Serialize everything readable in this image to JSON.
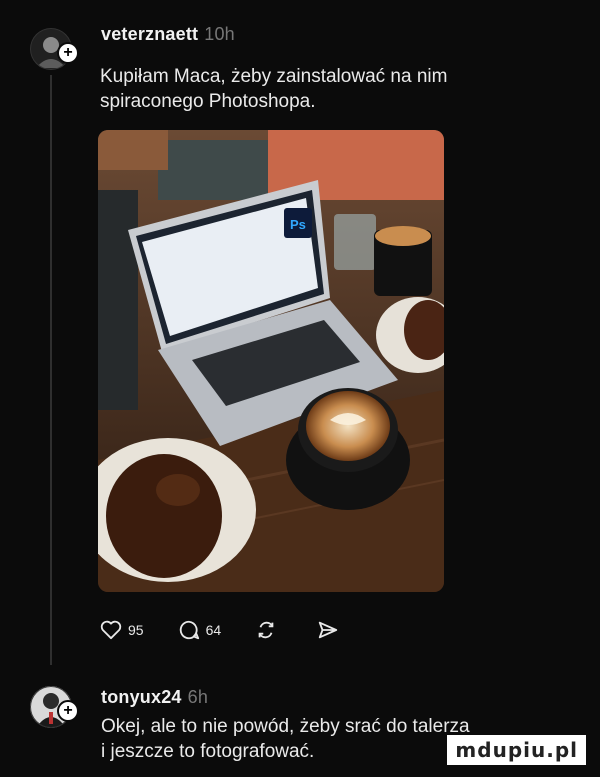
{
  "post": {
    "username": "veterznaett",
    "time": "10h",
    "text_line1": "Kupiłam Maca, żeby zainstalować na nim",
    "text_line2": "spiraconego Photoshopa.",
    "likes": "95",
    "comments": "64"
  },
  "reply": {
    "username": "tonyux24",
    "time": "6h",
    "text_line1": "Okej, ale to nie powód, żeby srać do talerza",
    "text_line2": "i jeszcze to fotografować."
  },
  "photo": {
    "ps_badge": "Ps"
  },
  "watermark": "mdupiu.pl",
  "icons": [
    "plus-icon",
    "heart-icon",
    "comment-icon",
    "repost-icon",
    "share-icon"
  ],
  "colors": {
    "background": "#0b0b0b",
    "text": "#f2f2f2",
    "muted": "#777777"
  }
}
